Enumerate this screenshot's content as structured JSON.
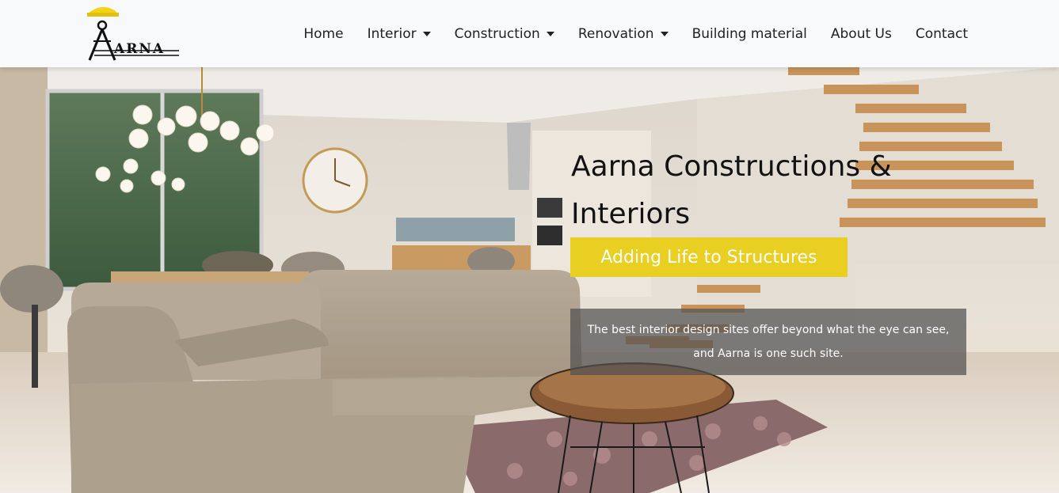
{
  "brand": {
    "logo_text": "ARNA"
  },
  "nav": {
    "items": [
      {
        "label": "Home"
      },
      {
        "label": "Interior"
      },
      {
        "label": "Construction"
      },
      {
        "label": "Renovation"
      },
      {
        "label": "Building material"
      },
      {
        "label": "About Us"
      },
      {
        "label": "Contact"
      }
    ]
  },
  "hero": {
    "title_line1": "Aarna Constructions &",
    "title_line2": "Interiors",
    "tagline": "Adding Life to Structures",
    "description_line1": "The best interior design sites offer beyond what the eye can see,",
    "description_line2": "and Aarna is one such site."
  },
  "colors": {
    "accent": "#e8cf22",
    "navbar_bg": "#f8f9fa",
    "text": "#222222"
  }
}
